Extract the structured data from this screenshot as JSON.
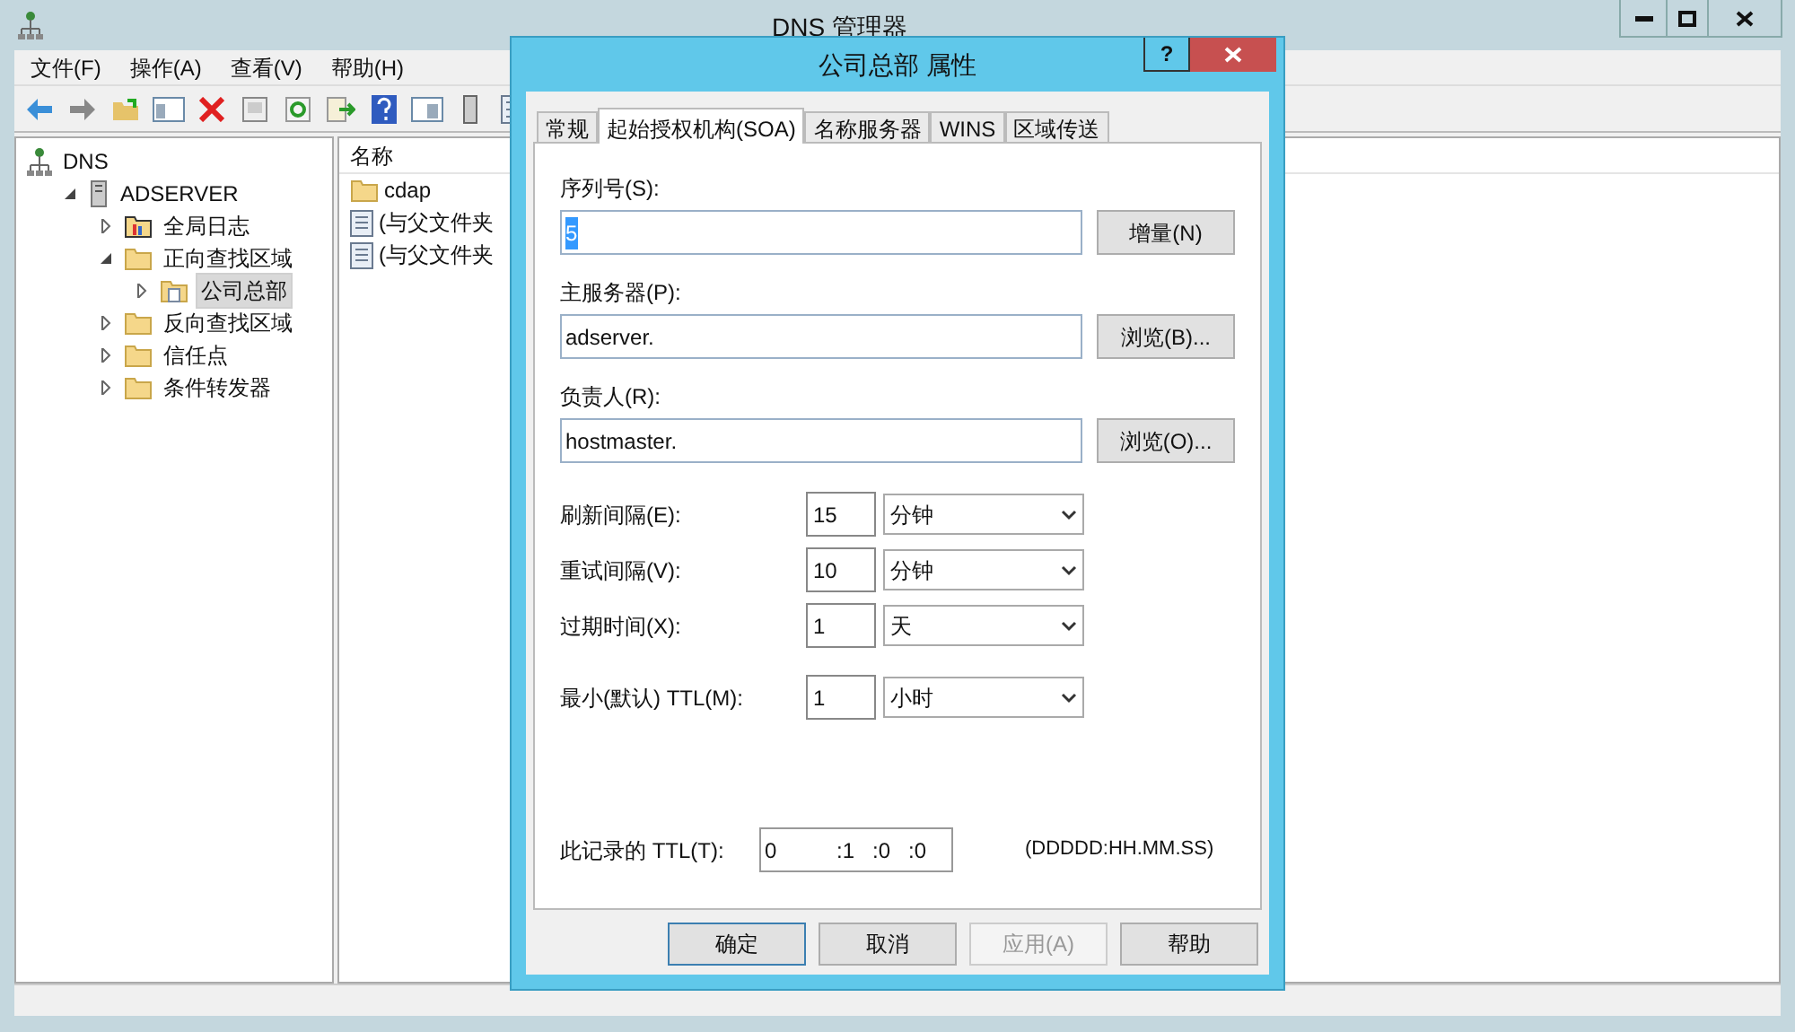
{
  "window": {
    "title": "DNS 管理器"
  },
  "menu": [
    "文件(F)",
    "操作(A)",
    "查看(V)",
    "帮助(H)"
  ],
  "tree": [
    {
      "label": "DNS",
      "kind": "root",
      "selected": false,
      "children": [
        {
          "label": "ADSERVER",
          "kind": "server",
          "expanded": true,
          "selected": false,
          "children": [
            {
              "label": "全局日志",
              "kind": "log",
              "expanded": false,
              "selected": false
            },
            {
              "label": "正向查找区域",
              "kind": "folder",
              "expanded": true,
              "selected": false,
              "children": [
                {
                  "label": "公司总部",
                  "kind": "zone",
                  "expanded": false,
                  "selected": true
                }
              ]
            },
            {
              "label": "反向查找区域",
              "kind": "folder",
              "expanded": false,
              "selected": false
            },
            {
              "label": "信任点",
              "kind": "folder",
              "expanded": false,
              "selected": false
            },
            {
              "label": "条件转发器",
              "kind": "folder",
              "expanded": false,
              "selected": false
            }
          ]
        }
      ]
    }
  ],
  "list": {
    "column": "名称",
    "rows": [
      {
        "name": "cdap",
        "kind": "folder"
      },
      {
        "name": "(与父文件夹",
        "kind": "record"
      },
      {
        "name": "(与父文件夹",
        "kind": "record"
      }
    ]
  },
  "dialog": {
    "title": "公司总部 属性",
    "help": "?",
    "tabs": [
      {
        "label": "常规",
        "selected": false
      },
      {
        "label": "起始授权机构(SOA)",
        "selected": true
      },
      {
        "label": "名称服务器",
        "selected": false
      },
      {
        "label": "WINS",
        "selected": false
      },
      {
        "label": "区域传送",
        "selected": false
      }
    ],
    "text_fields": [
      {
        "label": "序列号(S):",
        "value": "5",
        "button": "增量(N)",
        "highlighted": true
      },
      {
        "label": "主服务器(P):",
        "value": "adserver.",
        "button": "浏览(B)...",
        "highlighted": false
      },
      {
        "label": "负责人(R):",
        "value": "hostmaster.",
        "button": "浏览(O)...",
        "highlighted": false
      }
    ],
    "intervals": [
      {
        "label": "刷新间隔(E):",
        "value": "15",
        "unit": "分钟"
      },
      {
        "label": "重试间隔(V):",
        "value": "10",
        "unit": "分钟"
      },
      {
        "label": "过期时间(X):",
        "value": "1",
        "unit": "天"
      },
      {
        "label": "最小(默认) TTL(M):",
        "value": "1",
        "unit": "小时"
      }
    ],
    "ttl": {
      "label": "此记录的 TTL(T):",
      "days": "0",
      "hours": ":1",
      "minutes": ":0",
      "seconds": ":0",
      "format": "(DDDDD:HH.MM.SS)"
    },
    "buttons": [
      {
        "label": "确定",
        "disabled": false,
        "default": true
      },
      {
        "label": "取消",
        "disabled": false,
        "default": false
      },
      {
        "label": "应用(A)",
        "disabled": true,
        "default": false
      },
      {
        "label": "帮助",
        "disabled": false,
        "default": false
      }
    ]
  }
}
